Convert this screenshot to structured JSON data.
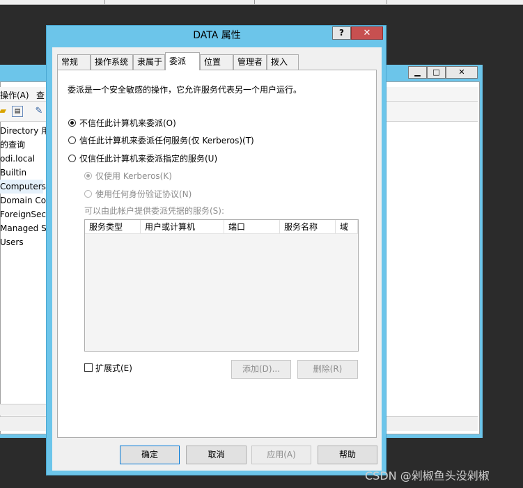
{
  "dialog": {
    "title": "DATA 属性",
    "help_label": "?",
    "close_label": "✕",
    "tabs": [
      "常规",
      "操作系统",
      "隶属于",
      "委派",
      "位置",
      "管理者",
      "拨入"
    ],
    "description": "委派是一个安全敏感的操作，它允许服务代表另一个用户运行。",
    "radios": [
      {
        "label": "不信任此计算机来委派(O)",
        "checked": true
      },
      {
        "label": "信任此计算机来委派任何服务(仅 Kerberos)(T)",
        "checked": false
      },
      {
        "label": "仅信任此计算机来委派指定的服务(U)",
        "checked": false
      }
    ],
    "sub_radios": [
      {
        "label": "仅使用 Kerberos(K)",
        "checked": true
      },
      {
        "label": "使用任何身份验证协议(N)",
        "checked": false
      }
    ],
    "services_label": "可以由此帐户提供委派凭据的服务(S):",
    "columns": [
      "服务类型",
      "用户或计算机",
      "端口",
      "服务名称",
      "域"
    ],
    "expanded_label": "扩展式(E)",
    "add_button": "添加(D)...",
    "remove_button": "删除(R)",
    "ok_button": "确定",
    "cancel_button": "取消",
    "apply_button": "应用(A)",
    "help_button": "帮助"
  },
  "background_window": {
    "controls": [
      "▁",
      "□",
      "✕"
    ],
    "menu": [
      "操作(A)",
      "查"
    ],
    "tree_items": [
      "Directory 用",
      "的查询",
      "odi.local",
      "Builtin",
      "Computers",
      "Domain Cor",
      "ForeignSecu",
      "Managed S",
      "Users"
    ]
  },
  "watermark": "CSDN @剁椒鱼头没剁椒"
}
